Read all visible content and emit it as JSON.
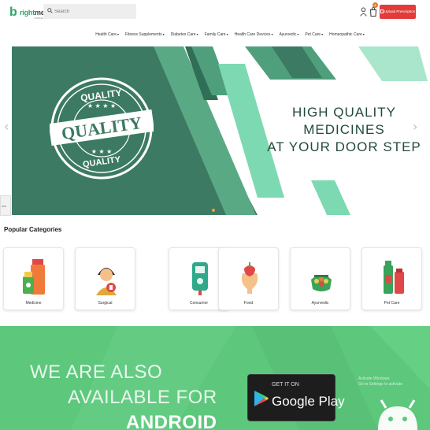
{
  "header": {
    "logo": {
      "mark": "b",
      "text_green": "right",
      "text_dark": "med",
      "tagline": "CURING YOU"
    },
    "search_placeholder": "Search",
    "cart_count": "0",
    "upload_button": "Upload Prescription"
  },
  "nav": [
    "Health Care",
    "Fitness Supplements",
    "Diabetes Care",
    "Family Care",
    "Health Care Devices",
    "Ayurvedic",
    "Pet Care",
    "Homeopathic Care"
  ],
  "hero": {
    "headline": [
      "HIGH QUALITY",
      "MEDICINES",
      "AT YOUR DOOR STEP"
    ],
    "stamp": {
      "top": "QUALITY",
      "center": "QUALITY",
      "bottom": "QUALITY"
    },
    "side_tab": "ora",
    "colors": {
      "dark_green": "#3c7a63",
      "mint": "#7dd9b1",
      "mid_green": "#4fa883"
    }
  },
  "categories": {
    "title": "Popular Categories",
    "items": [
      {
        "label": "Medicine",
        "icon": "medicine-icon"
      },
      {
        "label": "Surgical",
        "icon": "surgical-icon"
      },
      {
        "label": "Consumer",
        "icon": "consumer-icon"
      },
      {
        "label": "Food",
        "icon": "food-icon"
      },
      {
        "label": "Ayurvedic",
        "icon": "ayurvedic-icon"
      },
      {
        "label": "Pet Care",
        "icon": "pet-care-icon"
      }
    ]
  },
  "android": {
    "lines": [
      "WE ARE ALSO",
      "AVAILABLE FOR",
      "ANDROID"
    ],
    "badge_small": "GET IT ON",
    "badge_big": "Google Play",
    "activate_line1": "Activate Windows",
    "activate_line2": "Go to Settings to activate",
    "bg_color": "#5dc77c"
  }
}
